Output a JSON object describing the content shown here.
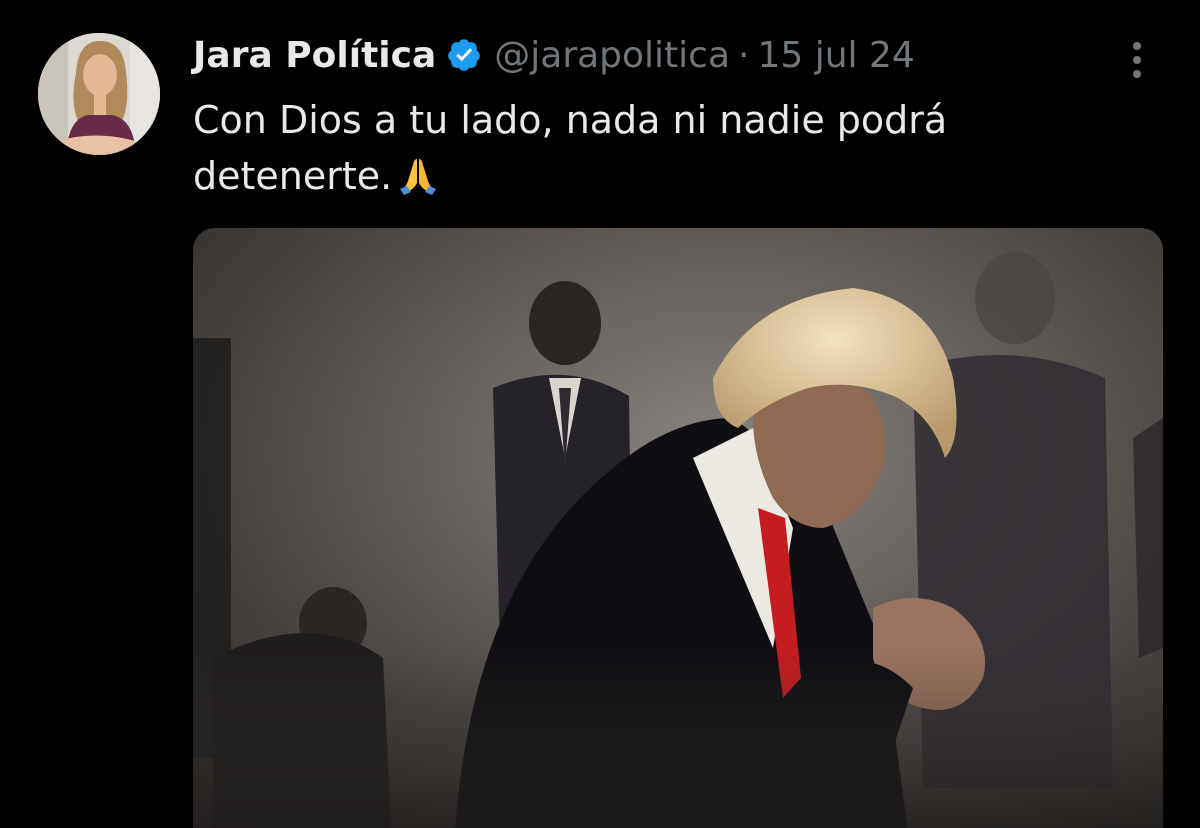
{
  "post": {
    "author_name": "Jara Política",
    "handle": "@jarapolitica",
    "separator": "·",
    "date": "15 jul 24",
    "text": "Con Dios a tu lado, nada ni nadie podrá detenerte.",
    "emoji": "folded-hands",
    "media_description_icon": "photo-person-praying"
  },
  "icons": {
    "verified": "verified-badge-icon",
    "more": "more-options-icon"
  },
  "colors": {
    "background": "#000000",
    "text_primary": "#e7e9ea",
    "text_secondary": "#71767b",
    "verified_blue": "#1d9bf0"
  }
}
